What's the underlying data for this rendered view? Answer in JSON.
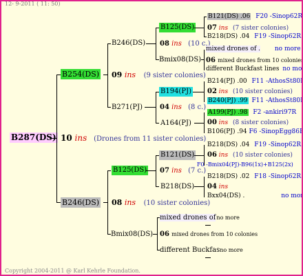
{
  "header": {
    "date": "12- 9-2011 ( 11: 50)"
  },
  "footer": {
    "copyright": "Copyright 2004-2011 @ Karl Kehrle Foundation."
  },
  "root": {
    "id": "B287(DS)",
    "gen_num": "10",
    "ins": "ins",
    "sisters": "(Drones from 11 sister colonies)"
  },
  "upper": {
    "id": "B254(DS)",
    "gen_num": "09",
    "ins": "ins",
    "sisters": "(9 sister colonies)",
    "b246": {
      "id": "B246(DS)",
      "gen_num": "08",
      "ins": "ins",
      "sisters": "(10 c.)",
      "b125": {
        "id": "B125(DS)",
        "gen_num": "07",
        "ins": "ins",
        "sisters": "(7 sister colonies)",
        "q1": "B121(DS) .06",
        "q1_code": "F20 -Sinop62R",
        "q2": "B218(DS) .04",
        "q2_code": "F19 -Sinop62R"
      },
      "bmix": {
        "id": "Bmix08(DS)",
        "gen_num": "06",
        "line1": "mixed drones of .",
        "line1_more": "no more",
        "line2": "mixed drones from 10 colonies",
        "line3": "different Buckfast lines",
        "line3_more": "no more"
      }
    },
    "b271": {
      "id": "B271(PJ)",
      "gen_num": "04",
      "ins": "ins",
      "sisters": "(8 c.)",
      "b194": {
        "id": "B194(PJ)",
        "gen_num": "02",
        "ins": "ins",
        "sisters": "(10 sister colonies)",
        "q1": "B214(PJ) .00",
        "q1_code": "F11 -AthosSt80R",
        "q2": "B240(PJ) .99",
        "q2_code": "F11 -AthosSt80R"
      },
      "a164": {
        "id": "A164(PJ)",
        "gen_num": "00",
        "ins": "ins",
        "sisters": "(8 sister colonies)",
        "q1": "A199(PJ) .98",
        "q1_code": "F2 -ankiri97R",
        "q2": "B106(PJ) .94",
        "q2_code": "F6 -SinopEgg86R"
      }
    }
  },
  "lower": {
    "id": "B246(DS)",
    "gen_num": "08",
    "ins": "ins",
    "sisters": "(10 sister colonies)",
    "b125": {
      "id": "B125(DS)",
      "gen_num": "07",
      "ins": "ins",
      "sisters": "(7 c.)",
      "b121": {
        "id": "B121(DS)",
        "gen_num": "06",
        "ins": "ins",
        "sisters": "(10 sister colonies)",
        "q1": "B218(DS) .04",
        "q1_code": "F19 -Sinop62R",
        "q2": "F0 -Bmix04(PJ)-B96(1x)+B125(2x)"
      },
      "b218": {
        "id": "B218(DS)",
        "gen_num": "04",
        "ins": "ins",
        "q1": "B218(DS) .02",
        "q1_code": "F18 -Sinop62R",
        "q2": "Bxx04(DS) .",
        "q2_more": "no more"
      }
    },
    "bmix": {
      "id": "Bmix08(DS)",
      "gen_num": "06",
      "line1": "mixed drones of",
      "line1_more": "no more",
      "line2": "mixed drones from 10 colonies",
      "line3": "different Buckfas",
      "line3_more": "no more"
    }
  },
  "colors": {
    "border": "#e0208c",
    "background": "#fffde0",
    "green": "#33dd33",
    "grey": "#bbbbbb",
    "cyan": "#22e0e0",
    "pink": "#ffccff",
    "ins": "#d00000",
    "code": "#0000cc"
  }
}
